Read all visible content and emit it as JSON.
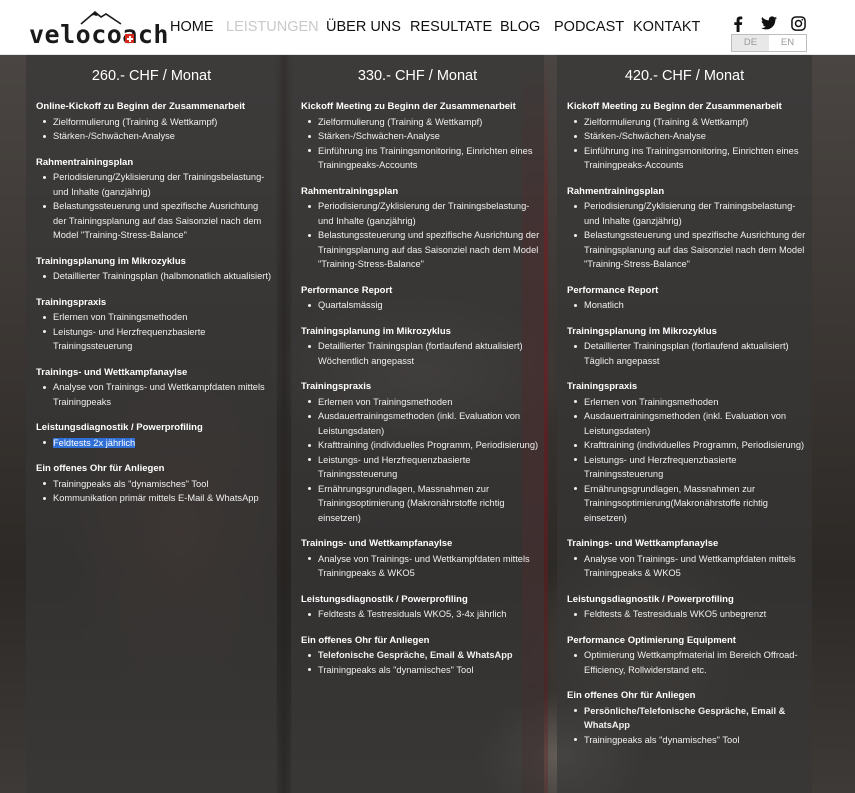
{
  "brand": {
    "name": "velocoach"
  },
  "nav": [
    {
      "label": "HOME",
      "active": false
    },
    {
      "label": "LEISTUNGEN",
      "active": true
    },
    {
      "label": "ÜBER UNS",
      "active": false
    },
    {
      "label": "RESULTATE",
      "active": false
    },
    {
      "label": "BLOG",
      "active": false
    },
    {
      "label": "PODCAST",
      "active": false
    },
    {
      "label": "KONTAKT",
      "active": false
    }
  ],
  "social": [
    "facebook-icon",
    "twitter-icon",
    "instagram-icon"
  ],
  "lang": {
    "de": "DE",
    "en": "EN",
    "active": "DE"
  },
  "plans": [
    {
      "title": "260.- CHF / Monat",
      "sections": [
        {
          "title": "Online-Kickoff zu Beginn der Zusammenarbeit",
          "items": [
            "Zielformulierung (Training & Wettkampf)",
            "Stärken-/Schwächen-Analyse"
          ]
        },
        {
          "title": "Rahmentrainingsplan",
          "items": [
            "Periodisierung/Zyklisierung der Trainingsbelastung- und Inhalte (ganzjährig)",
            "Belastungssteuerung und spezifische Ausrichtung der Trainingsplanung auf das Saisonziel nach dem Model \"Training-Stress-Balance\""
          ]
        },
        {
          "title": "Trainingsplanung im Mikrozyklus",
          "items": [
            "Detaillierter Trainingsplan (halbmonatlich aktualisiert)"
          ]
        },
        {
          "title": "Trainingspraxis",
          "items": [
            "Erlernen von Trainingsmethoden",
            "Leistungs- und Herzfrequenzbasierte Trainingssteuerung"
          ]
        },
        {
          "title": "Trainings- und Wettkampfanaylse",
          "items": [
            "Analyse von Trainings- und Wettkampfdaten mittels Trainingpeaks"
          ]
        },
        {
          "title": "Leistungsdiagnostik / Powerprofiling",
          "items": [
            "Feldtests 2x jährlich"
          ]
        },
        {
          "title": "Ein offenes Ohr für Anliegen",
          "items": [
            "Trainingpeaks als \"dynamisches\" Tool",
            "Kommunikation primär mittels E-Mail & WhatsApp"
          ]
        }
      ]
    },
    {
      "title": "330.- CHF / Monat",
      "sections": [
        {
          "title": "Kickoff Meeting zu Beginn der Zusammenarbeit",
          "items": [
            "Zielformulierung (Training & Wettkampf)",
            "Stärken-/Schwächen-Analyse",
            "Einführung ins Trainingsmonitoring, Einrichten eines Trainingpeaks-Accounts"
          ]
        },
        {
          "title": "Rahmentrainingsplan",
          "items": [
            "Periodisierung/Zyklisierung der Trainingsbelastung- und Inhalte (ganzjährig)",
            "Belastungssteuerung und spezifische Ausrichtung der Trainingsplanung auf das Saisonziel nach dem Model \"Training-Stress-Balance\""
          ]
        },
        {
          "title": "Performance Report",
          "items": [
            "Quartalsmässig"
          ]
        },
        {
          "title": "Trainingsplanung im Mikrozyklus",
          "items": [
            "Detaillierter Trainingsplan (fortlaufend aktualisiert) Wöchentlich angepasst"
          ]
        },
        {
          "title": "Trainingspraxis",
          "items": [
            "Erlernen von Trainingsmethoden",
            "Ausdauertrainingsmethoden (inkl. Evaluation von Leistungsdaten)",
            "Krafttraining (individuelles Programm, Periodisierung)",
            "Leistungs- und Herzfrequenzbasierte Trainingssteuerung",
            "Ernährungsgrundlagen, Massnahmen zur Trainingsoptimierung (Makronährstoffe richtig einsetzen)"
          ]
        },
        {
          "title": "Trainings- und Wettkampfanaylse",
          "items": [
            "Analyse von Trainings- und Wettkampfdaten mittels Trainingpeaks & WKO5"
          ]
        },
        {
          "title": "Leistungsdiagnostik / Powerprofiling",
          "items": [
            "Feldtests & Testresiduals WKO5, 3-4x jährlich"
          ]
        },
        {
          "title": "Ein offenes Ohr für Anliegen",
          "items": [
            "Telefonische Gespräche, Email & WhatsApp",
            "Trainingpeaks als \"dynamisches\" Tool"
          ]
        }
      ]
    },
    {
      "title": "420.- CHF / Monat",
      "sections": [
        {
          "title": "Kickoff Meeting zu Beginn der Zusammenarbeit",
          "items": [
            "Zielformulierung (Training & Wettkampf)",
            "Stärken-/Schwächen-Analyse",
            "Einführung ins Trainingsmonitoring, Einrichten eines Trainingpeaks-Accounts"
          ]
        },
        {
          "title": "Rahmentrainingsplan",
          "items": [
            "Periodisierung/Zyklisierung der Trainingsbelastung- und Inhalte (ganzjährig)",
            "Belastungssteuerung und spezifische Ausrichtung der Trainingsplanung auf das Saisonziel nach dem Model \"Training-Stress-Balance\""
          ]
        },
        {
          "title": "Performance Report",
          "items": [
            "Monatlich"
          ]
        },
        {
          "title": "Trainingsplanung im Mikrozyklus",
          "items": [
            "Detaillierter Trainingsplan (fortlaufend aktualisiert) Täglich angepasst"
          ]
        },
        {
          "title": "Trainingspraxis",
          "items": [
            "Erlernen von Trainingsmethoden",
            "Ausdauertrainingsmethoden (inkl. Evaluation von Leistungsdaten)",
            "Krafttraining (individuelles Programm, Periodisierung)",
            "Leistungs- und Herzfrequenzbasierte Trainingssteuerung",
            "Ernährungsgrundlagen, Massnahmen zur Trainingsoptimierung(Makronährstoffe richtig einsetzen)"
          ]
        },
        {
          "title": "Trainings- und Wettkampfanaylse",
          "items": [
            "Analyse von Trainings- und Wettkampfdaten mittels Trainingpeaks & WKO5"
          ]
        },
        {
          "title": "Leistungsdiagnostik / Powerprofiling",
          "items": [
            "Feldtests & Testresiduals WKO5 unbegrenzt"
          ]
        },
        {
          "title": "Performance Optimierung Equipment",
          "items": [
            "Optimierung Wettkampfmaterial im Bereich Offroad-Efficiency, Rollwiderstand etc."
          ]
        },
        {
          "title": "Ein offenes Ohr für Anliegen",
          "items": [
            "Persönliche/Telefonische Gespräche, Email & WhatsApp",
            "Trainingpeaks als \"dynamisches\" Tool"
          ]
        }
      ]
    }
  ]
}
